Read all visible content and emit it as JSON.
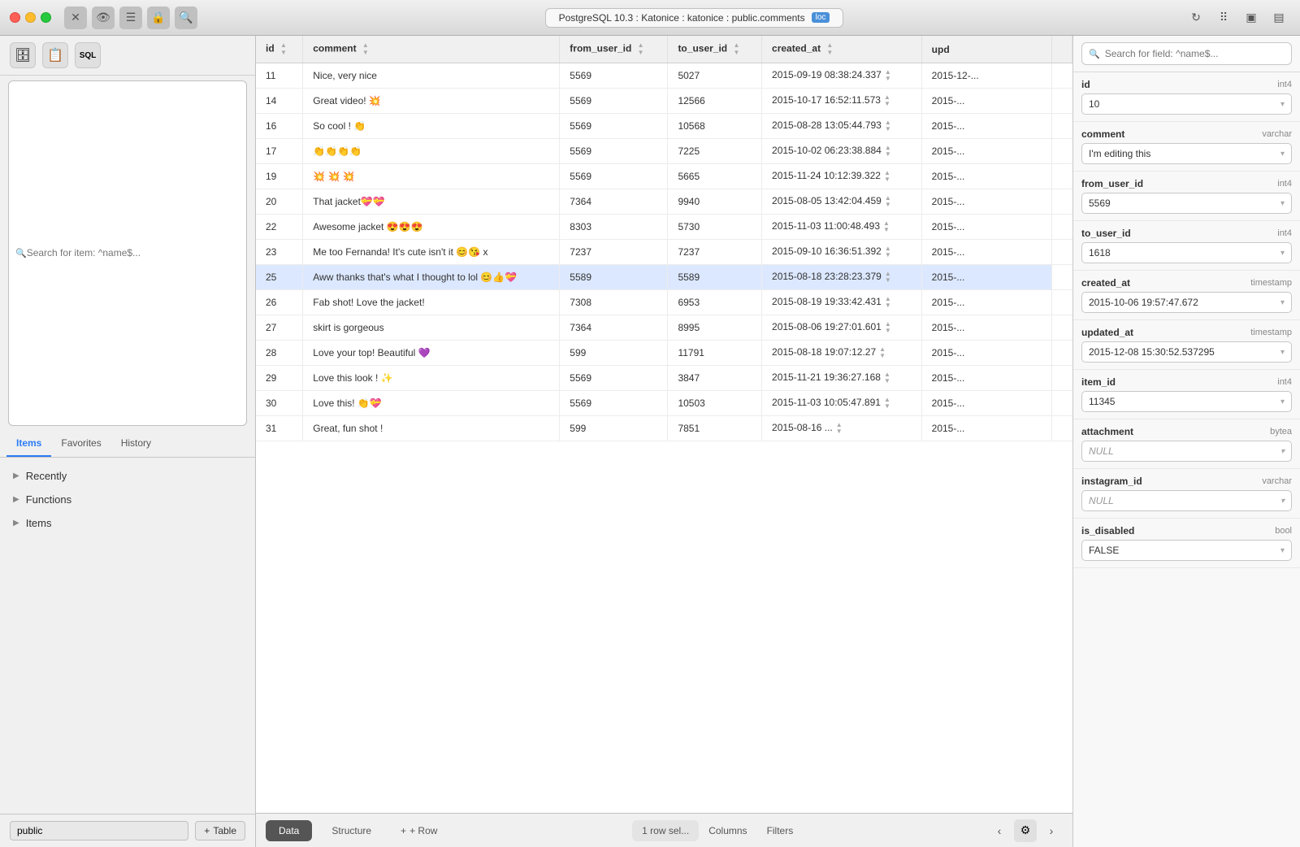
{
  "titlebar": {
    "traffic_lights": [
      "red",
      "yellow",
      "green"
    ],
    "icons": [
      "⊗",
      "👁",
      "≡",
      "🔒",
      "🔍"
    ],
    "connection": "PostgreSQL 10.3 : Katonice : katonice : public.comments",
    "loc_badge": "loc",
    "right_icons": [
      "↻",
      "⠿",
      "▣",
      "▤"
    ]
  },
  "sidebar": {
    "search_placeholder": "Search for item: ^name$...",
    "tabs": [
      "Items",
      "Favorites",
      "History"
    ],
    "active_tab": "Items",
    "nav_items": [
      {
        "label": "Recently",
        "expanded": false
      },
      {
        "label": "Functions",
        "expanded": false
      },
      {
        "label": "Items",
        "expanded": false
      }
    ],
    "schema": "public",
    "add_table_label": "+ Table"
  },
  "table": {
    "columns": [
      "id",
      "comment",
      "from_user_id",
      "to_user_id",
      "created_at",
      "upd"
    ],
    "rows": [
      {
        "id": "11",
        "comment": "Nice, very nice",
        "from_user_id": "5569",
        "to_user_id": "5027",
        "created_at": "2015-09-19 08:38:24.337",
        "upd": "2015-12-..."
      },
      {
        "id": "14",
        "comment": "Great video! 💥",
        "from_user_id": "5569",
        "to_user_id": "12566",
        "created_at": "2015-10-17 16:52:11.573",
        "upd": "2015-..."
      },
      {
        "id": "16",
        "comment": "So cool ! 👏",
        "from_user_id": "5569",
        "to_user_id": "10568",
        "created_at": "2015-08-28 13:05:44.793",
        "upd": "2015-..."
      },
      {
        "id": "17",
        "comment": "👏👏👏👏",
        "from_user_id": "5569",
        "to_user_id": "7225",
        "created_at": "2015-10-02 06:23:38.884",
        "upd": "2015-..."
      },
      {
        "id": "19",
        "comment": "💥 💥 💥",
        "from_user_id": "5569",
        "to_user_id": "5665",
        "created_at": "2015-11-24 10:12:39.322",
        "upd": "2015-..."
      },
      {
        "id": "20",
        "comment": "That jacket💝💝",
        "from_user_id": "7364",
        "to_user_id": "9940",
        "created_at": "2015-08-05 13:42:04.459",
        "upd": "2015-..."
      },
      {
        "id": "22",
        "comment": "Awesome jacket 😍😍😍",
        "from_user_id": "8303",
        "to_user_id": "5730",
        "created_at": "2015-11-03 11:00:48.493",
        "upd": "2015-..."
      },
      {
        "id": "23",
        "comment": "Me too Fernanda! It's cute isn't it 😊😘 x",
        "from_user_id": "7237",
        "to_user_id": "7237",
        "created_at": "2015-09-10 16:36:51.392",
        "upd": "2015-..."
      },
      {
        "id": "25",
        "comment": "Aww thanks that's what I thought to lol 😊👍💝",
        "from_user_id": "5589",
        "to_user_id": "5589",
        "created_at": "2015-08-18 23:28:23.379",
        "upd": "2015-..."
      },
      {
        "id": "26",
        "comment": "Fab shot! Love the jacket!",
        "from_user_id": "7308",
        "to_user_id": "6953",
        "created_at": "2015-08-19 19:33:42.431",
        "upd": "2015-..."
      },
      {
        "id": "27",
        "comment": "skirt is gorgeous",
        "from_user_id": "7364",
        "to_user_id": "8995",
        "created_at": "2015-08-06 19:27:01.601",
        "upd": "2015-..."
      },
      {
        "id": "28",
        "comment": "Love your top! Beautiful 💜",
        "from_user_id": "599",
        "to_user_id": "11791",
        "created_at": "2015-08-18 19:07:12.27",
        "upd": "2015-..."
      },
      {
        "id": "29",
        "comment": "Love this look ! ✨",
        "from_user_id": "5569",
        "to_user_id": "3847",
        "created_at": "2015-11-21 19:36:27.168",
        "upd": "2015-..."
      },
      {
        "id": "30",
        "comment": "Love this! 👏💝",
        "from_user_id": "5569",
        "to_user_id": "10503",
        "created_at": "2015-11-03 10:05:47.891",
        "upd": "2015-..."
      },
      {
        "id": "31",
        "comment": "Great, fun shot !",
        "from_user_id": "599",
        "to_user_id": "7851",
        "created_at": "2015-08-16 ...",
        "upd": "2015-..."
      }
    ],
    "selected_row_index": 8
  },
  "bottom_bar": {
    "tabs": [
      "Data",
      "Structure"
    ],
    "active_tab": "Data",
    "add_row_label": "+ Row",
    "row_info": "1 row sel...",
    "columns_label": "Columns",
    "filters_label": "Filters"
  },
  "right_panel": {
    "search_placeholder": "Search for field: ^name$...",
    "fields": [
      {
        "name": "id",
        "type": "int4",
        "value": "10",
        "null": false
      },
      {
        "name": "comment",
        "type": "varchar",
        "value": "I'm editing this",
        "null": false
      },
      {
        "name": "from_user_id",
        "type": "int4",
        "value": "5569",
        "null": false
      },
      {
        "name": "to_user_id",
        "type": "int4",
        "value": "1618",
        "null": false
      },
      {
        "name": "created_at",
        "type": "timestamp",
        "value": "2015-10-06 19:57:47.672",
        "null": false
      },
      {
        "name": "updated_at",
        "type": "timestamp",
        "value": "2015-12-08 15:30:52.537295",
        "null": false
      },
      {
        "name": "item_id",
        "type": "int4",
        "value": "11345",
        "null": false
      },
      {
        "name": "attachment",
        "type": "bytea",
        "value": "NULL",
        "null": true
      },
      {
        "name": "instagram_id",
        "type": "varchar",
        "value": "NULL",
        "null": true
      },
      {
        "name": "is_disabled",
        "type": "bool",
        "value": "FALSE",
        "null": false
      }
    ]
  }
}
